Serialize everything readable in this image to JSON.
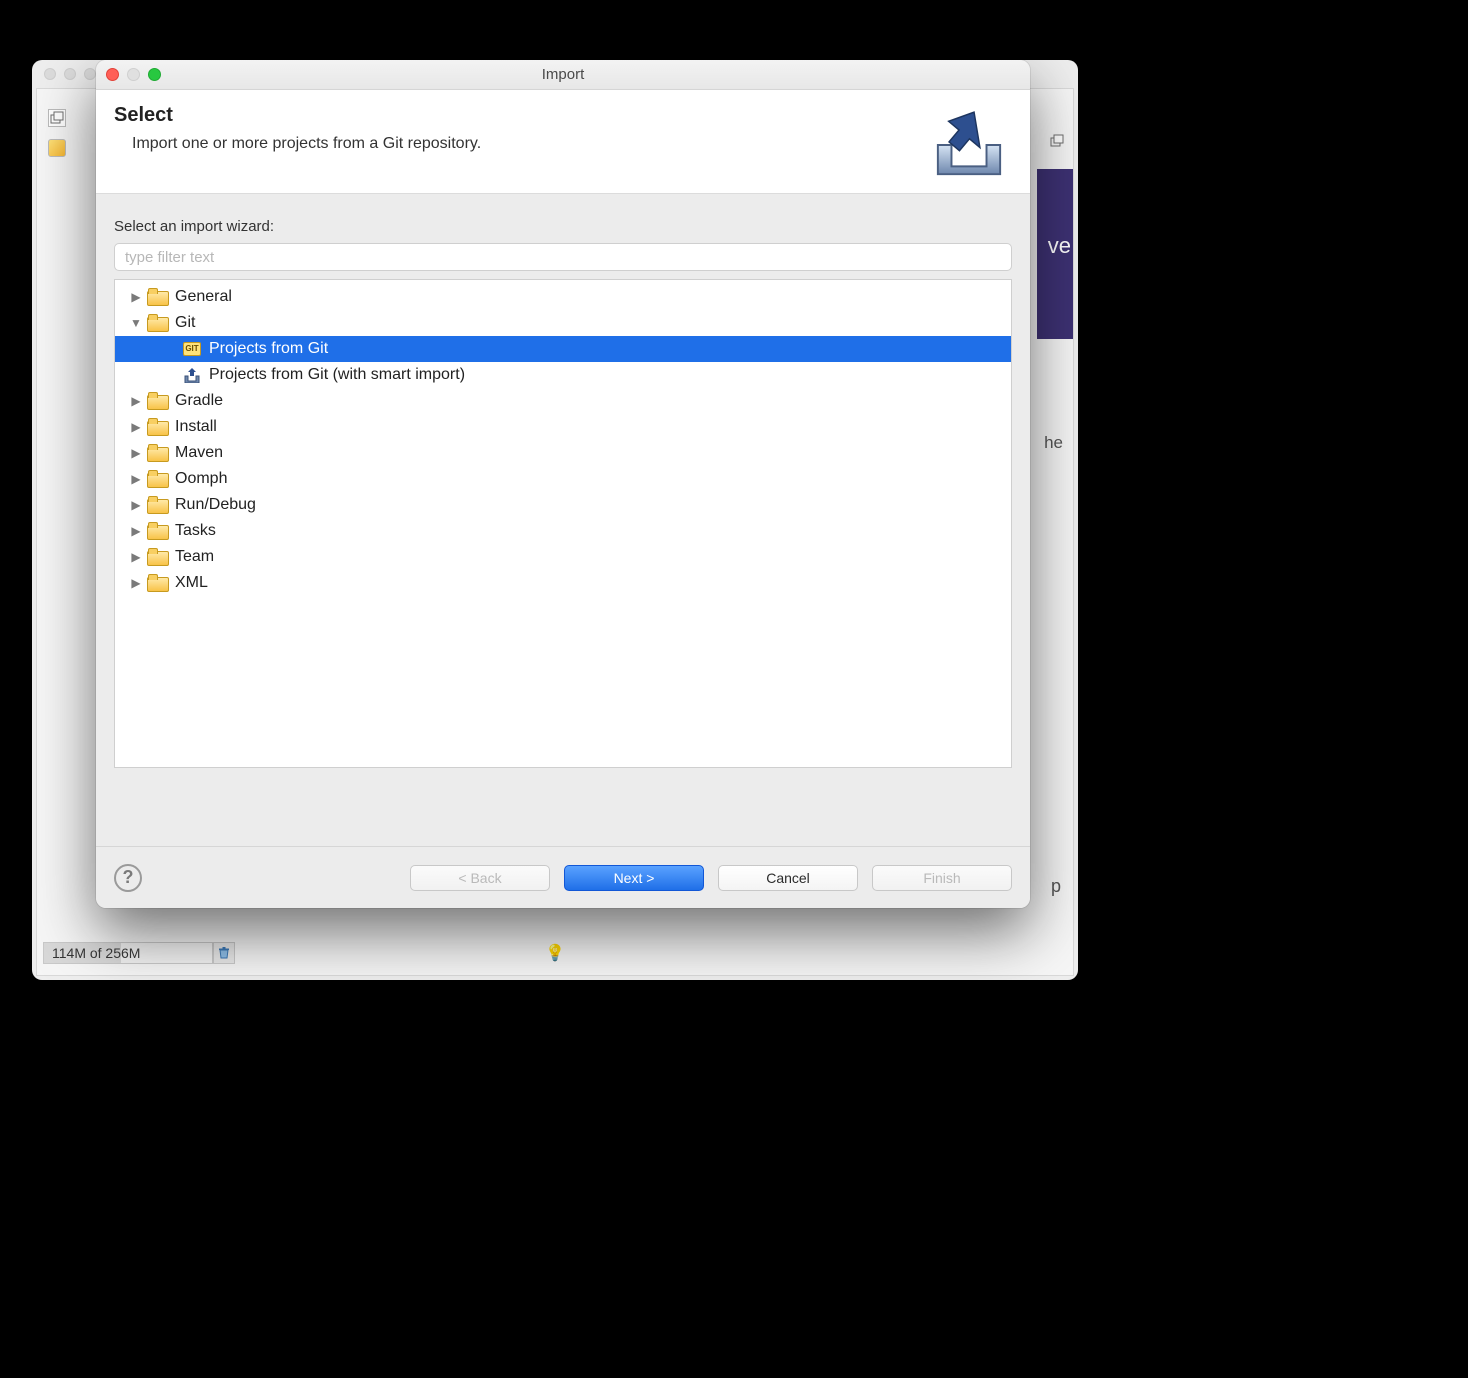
{
  "parent_window": {
    "heap_status": "114M of 256M"
  },
  "dialog": {
    "title": "Import",
    "banner_heading": "Select",
    "banner_sub": "Import one or more projects from a Git repository.",
    "filter_label": "Select an import wizard:",
    "filter_placeholder": "type filter text",
    "tree": [
      {
        "label": "General",
        "type": "folder",
        "indent": 0,
        "expanded": false,
        "selected": false,
        "icon": "folder"
      },
      {
        "label": "Git",
        "type": "folder",
        "indent": 0,
        "expanded": true,
        "selected": false,
        "icon": "folder"
      },
      {
        "label": "Projects from Git",
        "type": "item",
        "indent": 1,
        "expanded": false,
        "selected": true,
        "icon": "git"
      },
      {
        "label": "Projects from Git (with smart import)",
        "type": "item",
        "indent": 1,
        "expanded": false,
        "selected": false,
        "icon": "import"
      },
      {
        "label": "Gradle",
        "type": "folder",
        "indent": 0,
        "expanded": false,
        "selected": false,
        "icon": "folder"
      },
      {
        "label": "Install",
        "type": "folder",
        "indent": 0,
        "expanded": false,
        "selected": false,
        "icon": "folder"
      },
      {
        "label": "Maven",
        "type": "folder",
        "indent": 0,
        "expanded": false,
        "selected": false,
        "icon": "folder"
      },
      {
        "label": "Oomph",
        "type": "folder",
        "indent": 0,
        "expanded": false,
        "selected": false,
        "icon": "folder"
      },
      {
        "label": "Run/Debug",
        "type": "folder",
        "indent": 0,
        "expanded": false,
        "selected": false,
        "icon": "folder"
      },
      {
        "label": "Tasks",
        "type": "folder",
        "indent": 0,
        "expanded": false,
        "selected": false,
        "icon": "folder"
      },
      {
        "label": "Team",
        "type": "folder",
        "indent": 0,
        "expanded": false,
        "selected": false,
        "icon": "folder"
      },
      {
        "label": "XML",
        "type": "folder",
        "indent": 0,
        "expanded": false,
        "selected": false,
        "icon": "folder"
      }
    ],
    "buttons": {
      "back": "< Back",
      "next": "Next >",
      "cancel": "Cancel",
      "finish": "Finish"
    }
  }
}
